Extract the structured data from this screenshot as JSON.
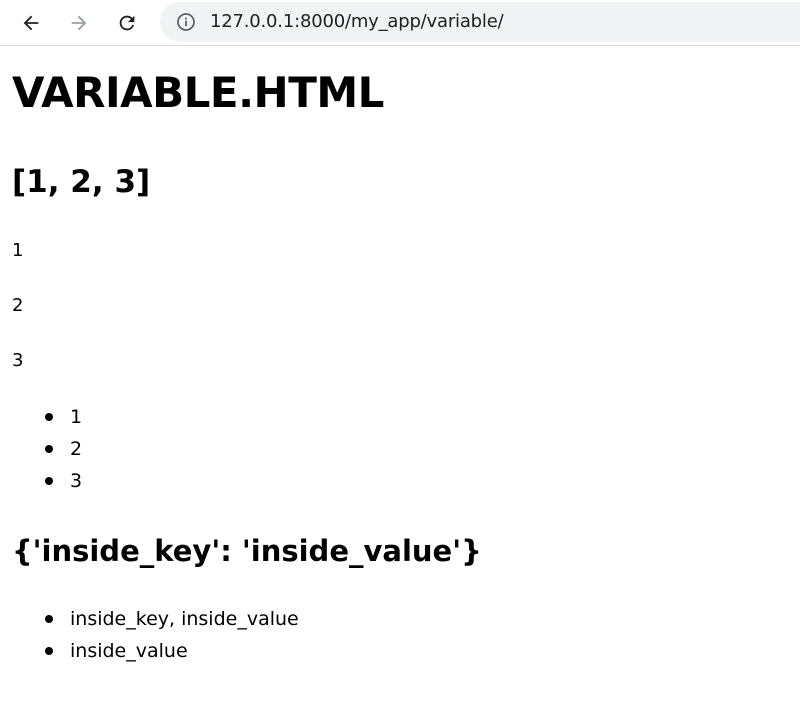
{
  "browser": {
    "url": "127.0.0.1:8000/my_app/variable/"
  },
  "page": {
    "title": "VARIABLE.HTML",
    "list_repr": "[1, 2, 3]",
    "paragraphs": [
      "1",
      "2",
      "3"
    ],
    "list_items": [
      "1",
      "2",
      "3"
    ],
    "dict_repr": "{'inside_key': 'inside_value'}",
    "dict_items": [
      "inside_key, inside_value",
      "inside_value"
    ]
  },
  "colors": {
    "toolbar_bg": "#ffffff",
    "omnibox_bg": "#f1f3f4",
    "icon_active": "#202124",
    "icon_disabled": "#9aa0a6"
  }
}
